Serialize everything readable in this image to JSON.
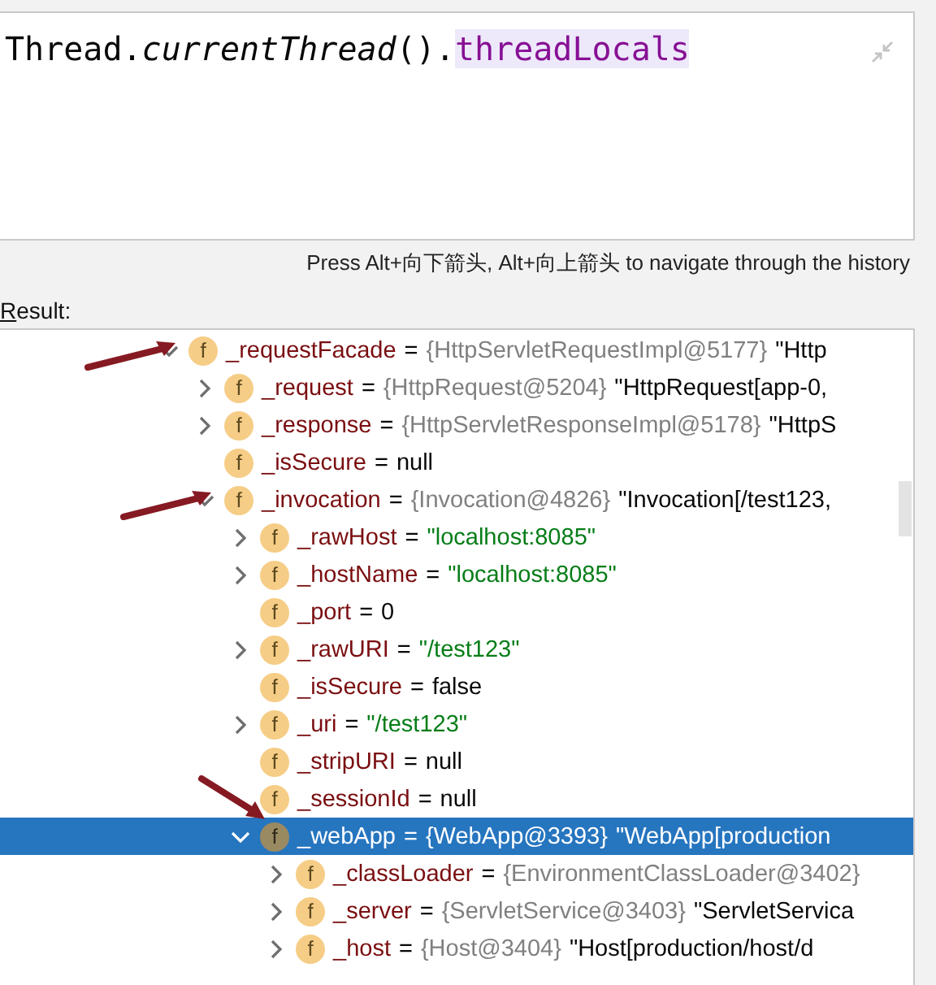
{
  "editor": {
    "code": [
      {
        "text": "Thread.",
        "kind": "plain"
      },
      {
        "text": "currentThread",
        "kind": "static-call"
      },
      {
        "text": "().",
        "kind": "plain"
      },
      {
        "text": "threadLocals",
        "kind": "field"
      }
    ]
  },
  "hint": "Press Alt+向下箭头, Alt+向上箭头 to navigate through the history",
  "result_label": "Result:",
  "tree": [
    {
      "badge": "f",
      "name": "_requestFacade",
      "eq": "=",
      "ref": "{HttpServletRequestImpl@5177}",
      "value": "\"Http",
      "kind": "text",
      "expanded": true,
      "selected": false,
      "pointer": {
        "kind": "from-left"
      },
      "children": [
        {
          "badge": "f",
          "name": "_request",
          "eq": "=",
          "ref": "{HttpRequest@5204}",
          "value": "\"HttpRequest[app-0,",
          "kind": "text",
          "expanded": false,
          "selected": false
        },
        {
          "badge": "f",
          "name": "_response",
          "eq": "=",
          "ref": "{HttpServletResponseImpl@5178}",
          "value": "\"HttpS",
          "kind": "text",
          "expanded": false,
          "selected": false
        },
        {
          "badge": "f",
          "name": "_isSecure",
          "eq": "=",
          "value": "null",
          "kind": "text",
          "selected": false
        },
        {
          "badge": "f",
          "name": "_invocation",
          "eq": "=",
          "ref": "{Invocation@4826}",
          "value": "\"Invocation[/test123,",
          "kind": "text",
          "expanded": true,
          "selected": false,
          "pointer": {
            "kind": "from-left"
          },
          "children": [
            {
              "badge": "f",
              "name": "_rawHost",
              "eq": "=",
              "value": "\"localhost:8085\"",
              "kind": "string",
              "expanded": false,
              "selected": false
            },
            {
              "badge": "f",
              "name": "_hostName",
              "eq": "=",
              "value": "\"localhost:8085\"",
              "kind": "string",
              "expanded": false,
              "selected": false
            },
            {
              "badge": "f",
              "name": "_port",
              "eq": "=",
              "value": "0",
              "kind": "text",
              "selected": false
            },
            {
              "badge": "f",
              "name": "_rawURI",
              "eq": "=",
              "value": "\"/test123\"",
              "kind": "string",
              "expanded": false,
              "selected": false
            },
            {
              "badge": "f",
              "name": "_isSecure",
              "eq": "=",
              "value": "false",
              "kind": "text",
              "selected": false
            },
            {
              "badge": "f",
              "name": "_uri",
              "eq": "=",
              "value": "\"/test123\"",
              "kind": "string",
              "expanded": false,
              "selected": false
            },
            {
              "badge": "f",
              "name": "_stripURI",
              "eq": "=",
              "value": "null",
              "kind": "text",
              "selected": false
            },
            {
              "badge": "f",
              "name": "_sessionId",
              "eq": "=",
              "value": "null",
              "kind": "text",
              "selected": false
            },
            {
              "badge": "f",
              "name": "_webApp",
              "eq": "=",
              "ref": "{WebApp@3393}",
              "value": "\"WebApp[production",
              "kind": "text",
              "expanded": true,
              "selected": true,
              "pointer": {
                "kind": "from-above"
              },
              "children": [
                {
                  "badge": "f",
                  "name": "_classLoader",
                  "eq": "=",
                  "ref": "{EnvironmentClassLoader@3402}",
                  "expanded": false,
                  "selected": false
                },
                {
                  "badge": "f",
                  "name": "_server",
                  "eq": "=",
                  "ref": "{ServletService@3403}",
                  "value": "\"ServletServica",
                  "kind": "text",
                  "expanded": false,
                  "selected": false
                },
                {
                  "badge": "f",
                  "name": "_host",
                  "eq": "=",
                  "ref": "{Host@3404}",
                  "value": "\"Host[production/host/d",
                  "kind": "text",
                  "expanded": false,
                  "selected": false
                }
              ]
            }
          ]
        }
      ]
    }
  ]
}
